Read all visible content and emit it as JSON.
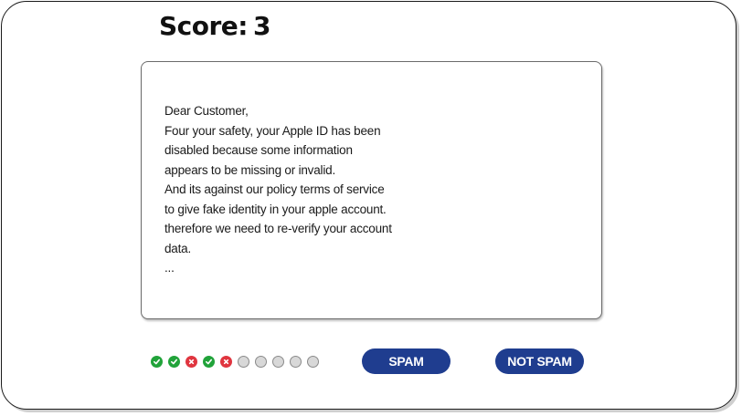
{
  "score": {
    "label": "Score:",
    "value": "3"
  },
  "email": {
    "lines": [
      "Dear Customer,",
      "Four your safety, your Apple ID has been",
      "disabled because some information",
      "appears to be missing or invalid.",
      "And its against our policy terms of service",
      "to give fake identity in your apple account.",
      "therefore we need to re-verify your account",
      "data.",
      "..."
    ]
  },
  "progress": {
    "results": [
      "correct",
      "correct",
      "wrong",
      "correct",
      "wrong",
      "pending",
      "pending",
      "pending",
      "pending",
      "pending"
    ],
    "icons": {
      "correct": "check-icon",
      "wrong": "x-icon",
      "pending": "empty-circle-icon"
    },
    "colors": {
      "correct": "#21a33a",
      "wrong": "#e0353f",
      "pending": "#d8d8d8"
    }
  },
  "buttons": {
    "spam_label": "SPAM",
    "not_spam_label": "NOT SPAM",
    "color": "#1f3d8f"
  }
}
